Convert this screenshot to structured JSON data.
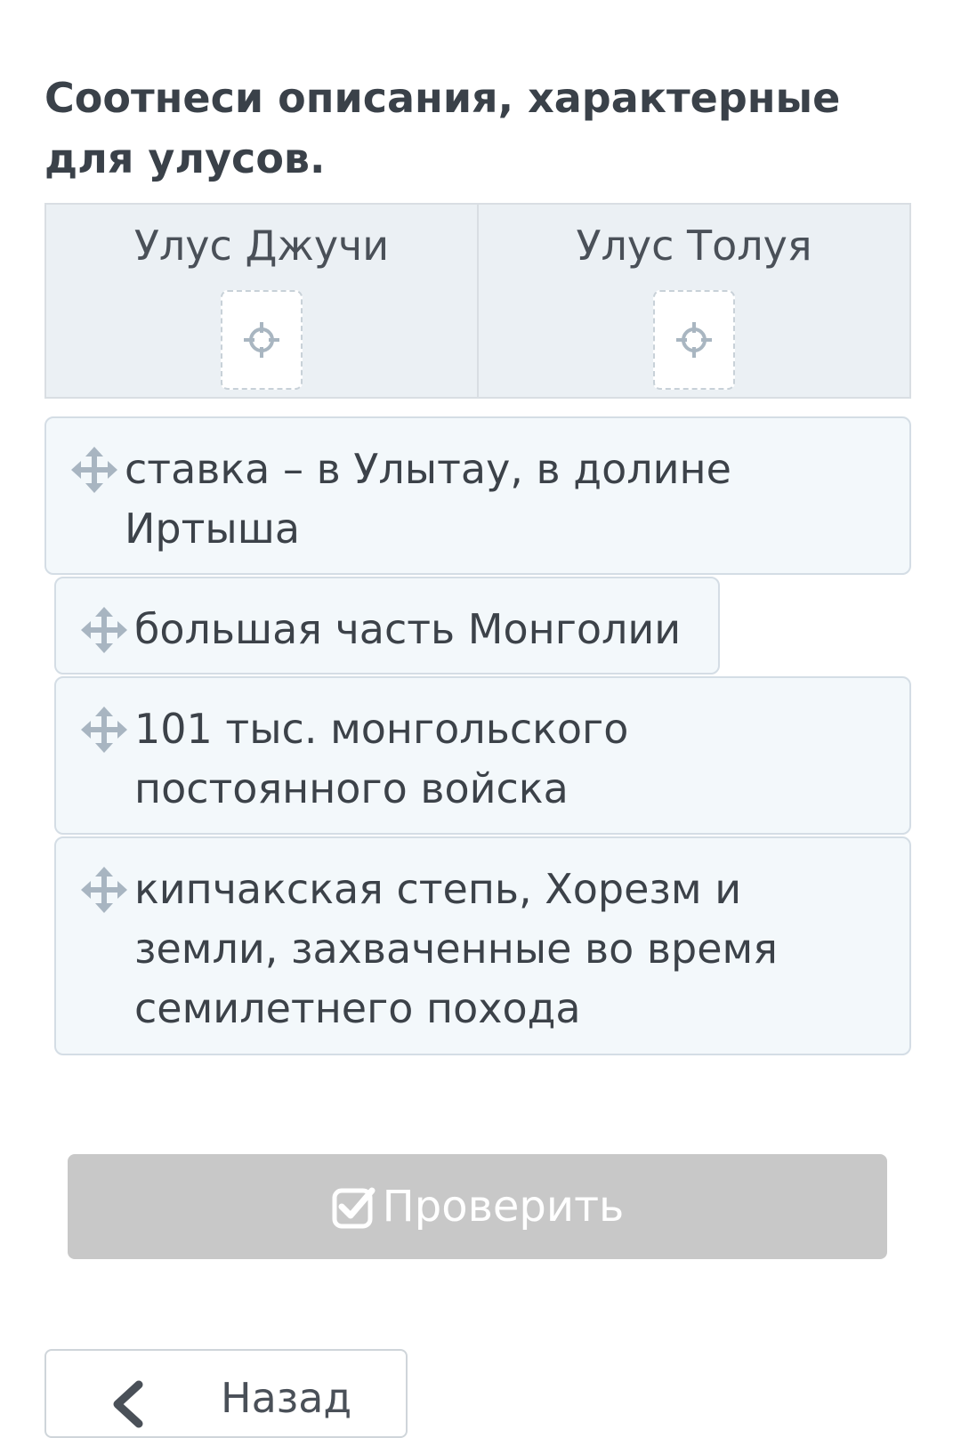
{
  "task": {
    "title": "Соотнеси описания, характерные для улусов."
  },
  "targets": [
    {
      "label": "Улус Джучи",
      "drop_icon": "crosshair-icon"
    },
    {
      "label": "Улус Толуя",
      "drop_icon": "crosshair-icon"
    }
  ],
  "cards": [
    {
      "text": "ставка – в Улытау, в долине Иртыша",
      "icon": "move-icon"
    },
    {
      "text": "большая часть Монголии",
      "icon": "move-icon"
    },
    {
      "text": "101 тыс. монгольского постоянного войска",
      "icon": "move-icon"
    },
    {
      "text": "кипчакская степь, Хорезм и земли, захваченные во время семилетнего похода",
      "icon": "move-icon"
    }
  ],
  "actions": {
    "check_label": "Проверить",
    "check_icon": "check-square-icon",
    "back_label": "Назад",
    "back_icon": "chevron-left-icon"
  },
  "colors": {
    "check_button_disabled": "#c8c8c8",
    "target_header_bg": "#ebf0f4",
    "card_bg": "#f3f8fb"
  }
}
